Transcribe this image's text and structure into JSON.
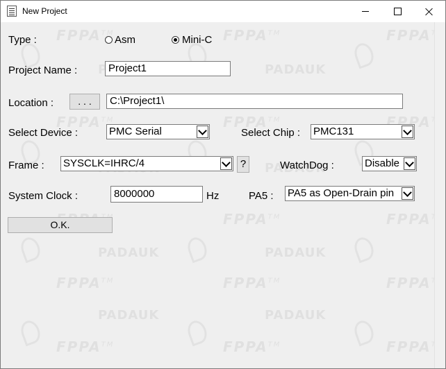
{
  "window": {
    "title": "New Project"
  },
  "watermark": {
    "fppa": "FPPA",
    "tm": "TM",
    "padauk": "PADAUK"
  },
  "form": {
    "type_label": "Type :",
    "type_options": [
      "Asm",
      "Mini-C"
    ],
    "type_selected": "Mini-C",
    "project_name_label": "Project Name :",
    "project_name_value": "Project1",
    "location_label": "Location :",
    "browse_label": ". . .",
    "location_value": "C:\\Project1\\",
    "select_device_label": "Select Device :",
    "select_device_value": "PMC Serial",
    "select_chip_label": "Select Chip :",
    "select_chip_value": "PMC131",
    "frame_label": "Frame   :",
    "frame_value": "SYSCLK=IHRC/4",
    "frame_help_label": "?",
    "watchdog_label": "WatchDog   :",
    "watchdog_value": "Disable",
    "system_clock_label": "System Clock   :",
    "system_clock_value": "8000000",
    "system_clock_unit": "Hz",
    "pa5_label": "PA5   :",
    "pa5_value": "PA5 as Open-Drain pin",
    "ok_label": "O.K."
  }
}
